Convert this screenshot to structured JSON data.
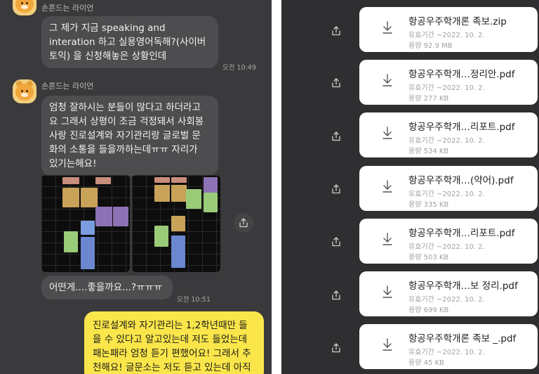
{
  "left_chat": {
    "sender_name": "손흔드는 라이언",
    "messages": [
      {
        "lines": [
          "그 제가 지금  speaking and",
          "interation 하고 실용영어독해?(사이버",
          "토익) 을 신청해놓은 상황인데"
        ],
        "time": "오전 10:49"
      },
      {
        "lines": [
          "엄청 잘하시는 분들이 많다고 하더라고",
          "요 그래서 상평이 조금 걱정돼서 사회봉",
          "사랑 진로설계와 자기관리랑 글로벌 문",
          "화의 소통을 들을까하는데ㅠㅠ 자리가",
          "있기는해요!"
        ]
      },
      {
        "lines": [
          "어떤게....좋을까요...?ㅠㅠㅠ"
        ],
        "time": "오전 10:51"
      }
    ],
    "my_message": {
      "lines": [
        "진로설계와 자기관리는 1,2학년때만 들",
        "을 수 있다고 알고있는데 저도 들었는데",
        "패논패라 엄청 듣기 편했어요! 그래서 추",
        "천해요! 글문소는 저도 듣고 있는데 아직"
      ]
    },
    "icons": {
      "share": "share-icon",
      "avatar": "ryan-avatar"
    }
  },
  "files": {
    "expiry_label": "유효기간",
    "size_label": "용량",
    "items": [
      {
        "name": "항공우주학개론 족보.zip",
        "expiry": "~2022. 10. 2.",
        "size": "92.9 MB"
      },
      {
        "name": "항공우주학개…정리안.pdf",
        "expiry": "~2022. 10. 2.",
        "size": "277 KB"
      },
      {
        "name": "항공우주학개…리포트.pdf",
        "expiry": "~2022. 10. 2.",
        "size": "534 KB"
      },
      {
        "name": "항공우주학개…(약어).pdf",
        "expiry": "~2022. 10. 2.",
        "size": "335 KB"
      },
      {
        "name": "항공우주학개…리포트.pdf",
        "expiry": "~2022. 10. 2.",
        "size": "503 KB"
      },
      {
        "name": "항공우주학개…보 정리.pdf",
        "expiry": "~2022. 10. 2.",
        "size": "699 KB"
      },
      {
        "name": "항공우주학개론 족보 _.pdf",
        "expiry": "~2022. 10. 2.",
        "size": "45 KB"
      }
    ],
    "icons": {
      "share": "share-icon",
      "download": "download-icon"
    }
  },
  "colors": {
    "chat_bg": "#3a3a3c",
    "bubble_other": "#4d4d4f",
    "bubble_me": "#fae64a",
    "files_bg": "#2f2f31",
    "card_bg": "#ffffff"
  }
}
